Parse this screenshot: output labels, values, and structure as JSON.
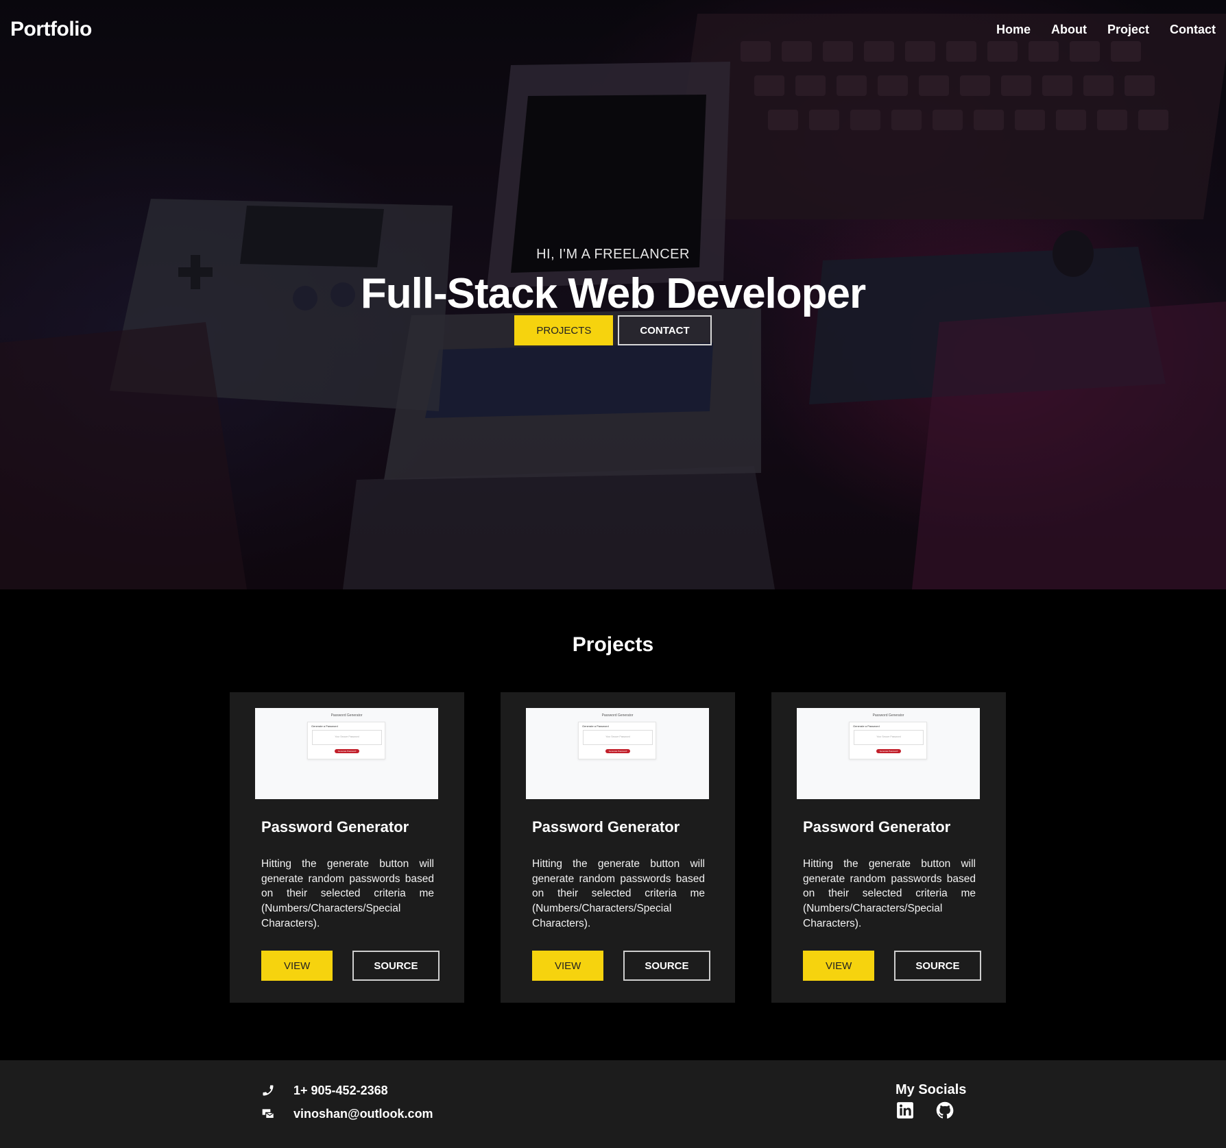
{
  "nav": {
    "logo": "Portfolio",
    "links": [
      "Home",
      "About",
      "Project",
      "Contact"
    ]
  },
  "hero": {
    "kicker": "HI, I'M A FREELANCER",
    "title": "Full-Stack Web Developer",
    "primary_button": "PROJECTS",
    "secondary_button": "CONTACT"
  },
  "projects": {
    "title": "Projects",
    "cards": [
      {
        "title": "Password Generator",
        "description": "Hitting the generate button will generate random passwords based on their selected criteria me (Numbers/Characters/Special Characters).",
        "view_label": "VIEW",
        "source_label": "SOURCE",
        "thumb": {
          "title": "Password Generator",
          "label": "Generate a Password",
          "placeholder": "Your Secure Password",
          "button": "Generate Password"
        }
      },
      {
        "title": "Password Generator",
        "description": "Hitting the generate button will generate random passwords based on their selected criteria me (Numbers/Characters/Special Characters).",
        "view_label": "VIEW",
        "source_label": "SOURCE",
        "thumb": {
          "title": "Password Generator",
          "label": "Generate a Password",
          "placeholder": "Your Secure Password",
          "button": "Generate Password"
        }
      },
      {
        "title": "Password Generator",
        "description": "Hitting the generate button will generate random passwords based on their selected criteria me (Numbers/Characters/Special Characters).",
        "view_label": "VIEW",
        "source_label": "SOURCE",
        "thumb": {
          "title": "Password Generator",
          "label": "Generate a Password",
          "placeholder": "Your Secure Password",
          "button": "Generate Password"
        }
      }
    ]
  },
  "footer": {
    "phone": "1+ 905-452-2368",
    "email": "vinoshan@outlook.com",
    "socials_title": "My Socials",
    "social_icons": [
      "linkedin-icon",
      "github-icon"
    ]
  },
  "colors": {
    "accent": "#f6d30e",
    "card_bg": "#1c1c1c",
    "footer_bg": "#1c1c1c",
    "page_bg": "#000000"
  }
}
